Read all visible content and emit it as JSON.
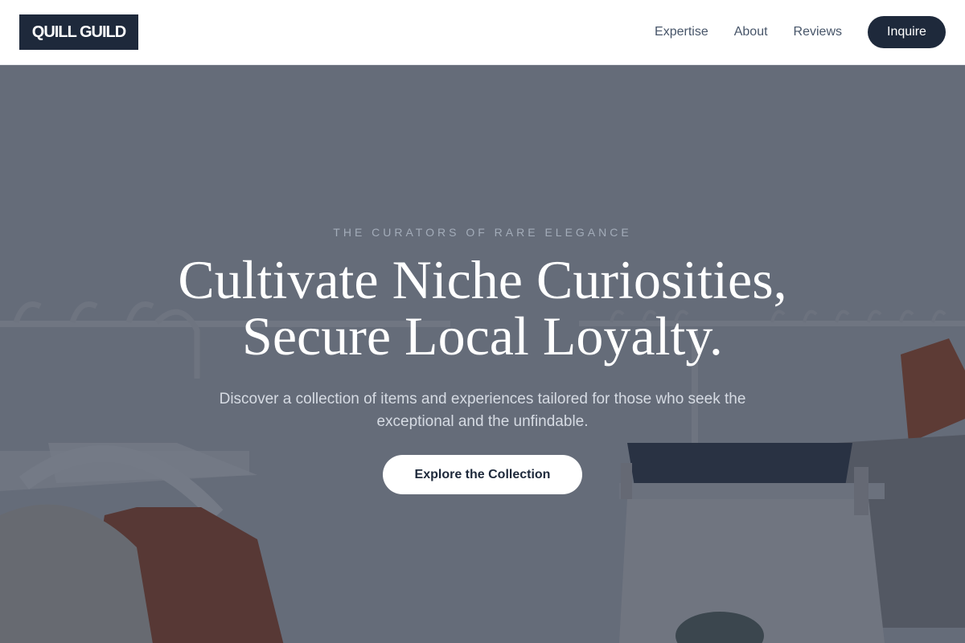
{
  "header": {
    "logo": "QUILL GUILD",
    "nav": [
      {
        "label": "Expertise"
      },
      {
        "label": "About"
      },
      {
        "label": "Reviews"
      }
    ],
    "cta_label": "Inquire"
  },
  "hero": {
    "eyebrow": "THE CURATORS OF RARE ELEGANCE",
    "headline_line1": "Cultivate Niche Curiosities,",
    "headline_line2": "Secure Local Loyalty.",
    "subtext": "Discover a collection of items and experiences tailored for those who seek the exceptional and the unfindable.",
    "cta_label": "Explore the Collection",
    "background_description_icon": "clothing-rack-photo"
  },
  "colors": {
    "navy": "#1e293b",
    "nav_text": "#475569",
    "white": "#ffffff",
    "overlay": "rgba(31,41,59,0.62)"
  }
}
